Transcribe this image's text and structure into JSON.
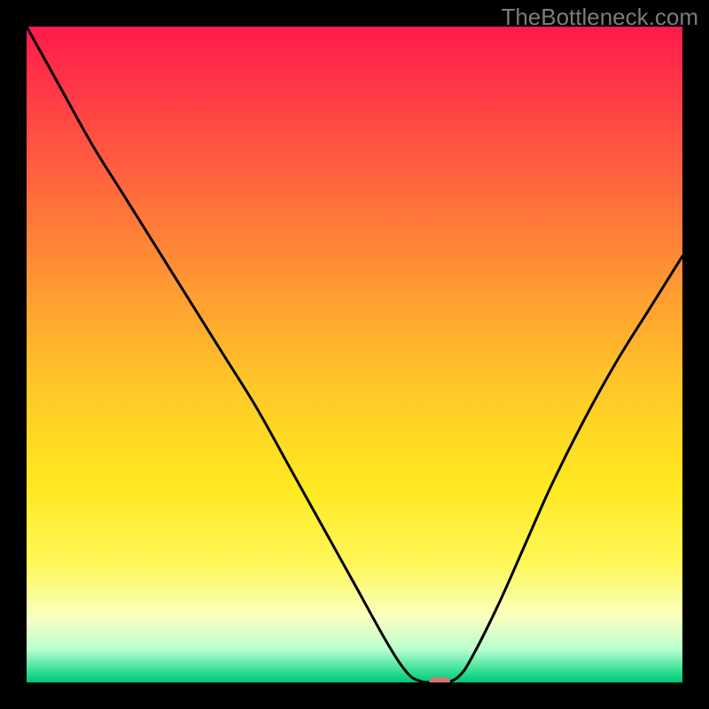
{
  "watermark": "TheBottleneck.com",
  "chart_data": {
    "type": "line",
    "title": "",
    "xlabel": "",
    "ylabel": "",
    "xlim": [
      0,
      100
    ],
    "ylim": [
      0,
      100
    ],
    "grid": false,
    "legend": false,
    "background_gradient": {
      "stops": [
        {
          "pos": 0.0,
          "color": "#ff1a4b"
        },
        {
          "pos": 0.1,
          "color": "#ff3a46"
        },
        {
          "pos": 0.25,
          "color": "#ff6a3c"
        },
        {
          "pos": 0.4,
          "color": "#ff9a32"
        },
        {
          "pos": 0.55,
          "color": "#ffc828"
        },
        {
          "pos": 0.7,
          "color": "#ffe820"
        },
        {
          "pos": 0.82,
          "color": "#fff85a"
        },
        {
          "pos": 0.9,
          "color": "#fbffc0"
        },
        {
          "pos": 0.95,
          "color": "#b8ffd0"
        },
        {
          "pos": 0.985,
          "color": "#2bdc90"
        },
        {
          "pos": 1.0,
          "color": "#00c776"
        }
      ]
    },
    "series": [
      {
        "name": "bottleneck-curve",
        "color": "#000000",
        "x": [
          0,
          5,
          10,
          15,
          20,
          25,
          30,
          35,
          40,
          45,
          50,
          55,
          58,
          60,
          62,
          64,
          66,
          68,
          72,
          76,
          80,
          85,
          90,
          95,
          100
        ],
        "y": [
          100,
          91,
          82,
          74,
          66,
          58,
          50,
          42,
          33,
          24,
          15,
          6,
          1.5,
          0.2,
          0,
          0,
          1,
          4,
          12,
          21,
          30,
          40,
          49,
          57,
          65
        ]
      }
    ],
    "marker": {
      "name": "optimal-point",
      "x": 63,
      "y": 0,
      "color": "#d6776e",
      "shape": "rounded-rect",
      "width_pct": 3.2,
      "height_pct": 1.6
    }
  }
}
